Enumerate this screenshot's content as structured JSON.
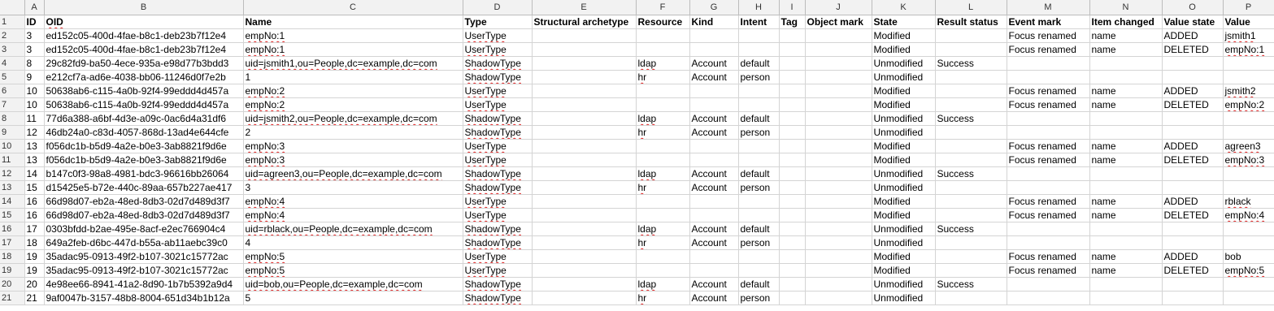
{
  "columns": [
    "A",
    "B",
    "C",
    "D",
    "E",
    "F",
    "G",
    "H",
    "I",
    "J",
    "K",
    "L",
    "M",
    "N",
    "O",
    "P"
  ],
  "header": [
    "ID",
    "OID",
    "Name",
    "Type",
    "Structural archetype",
    "Resource",
    "Kind",
    "Intent",
    "Tag",
    "Object mark",
    "State",
    "Result status",
    "Event mark",
    "Item changed",
    "Value state",
    "Value"
  ],
  "rows": [
    [
      "3",
      "ed152c05-400d-4fae-b8c1-deb23b7f12e4",
      "empNo:1",
      "UserType",
      "",
      "",
      "",
      "",
      "",
      "",
      "Modified",
      "",
      "Focus renamed",
      "name",
      "ADDED",
      "jsmith1"
    ],
    [
      "3",
      "ed152c05-400d-4fae-b8c1-deb23b7f12e4",
      "empNo:1",
      "UserType",
      "",
      "",
      "",
      "",
      "",
      "",
      "Modified",
      "",
      "Focus renamed",
      "name",
      "DELETED",
      "empNo:1"
    ],
    [
      "8",
      "29c82fd9-ba50-4ece-935a-e98d77b3bdd3",
      "uid=jsmith1,ou=People,dc=example,dc=com",
      "ShadowType",
      "",
      "ldap",
      "Account",
      "default",
      "",
      "",
      "Unmodified",
      "Success",
      "",
      "",
      "",
      ""
    ],
    [
      "9",
      "e212cf7a-ad6e-4038-bb06-11246d0f7e2b",
      "1",
      "ShadowType",
      "",
      "hr",
      "Account",
      "person",
      "",
      "",
      "Unmodified",
      "",
      "",
      "",
      "",
      ""
    ],
    [
      "10",
      "50638ab6-c115-4a0b-92f4-99eddd4d457a",
      "empNo:2",
      "UserType",
      "",
      "",
      "",
      "",
      "",
      "",
      "Modified",
      "",
      "Focus renamed",
      "name",
      "ADDED",
      "jsmith2"
    ],
    [
      "10",
      "50638ab6-c115-4a0b-92f4-99eddd4d457a",
      "empNo:2",
      "UserType",
      "",
      "",
      "",
      "",
      "",
      "",
      "Modified",
      "",
      "Focus renamed",
      "name",
      "DELETED",
      "empNo:2"
    ],
    [
      "11",
      "77d6a388-a6bf-4d3e-a09c-0ac6d4a31df6",
      "uid=jsmith2,ou=People,dc=example,dc=com",
      "ShadowType",
      "",
      "ldap",
      "Account",
      "default",
      "",
      "",
      "Unmodified",
      "Success",
      "",
      "",
      "",
      ""
    ],
    [
      "12",
      "46db24a0-c83d-4057-868d-13ad4e644cfe",
      "2",
      "ShadowType",
      "",
      "hr",
      "Account",
      "person",
      "",
      "",
      "Unmodified",
      "",
      "",
      "",
      "",
      ""
    ],
    [
      "13",
      "f056dc1b-b5d9-4a2e-b0e3-3ab8821f9d6e",
      "empNo:3",
      "UserType",
      "",
      "",
      "",
      "",
      "",
      "",
      "Modified",
      "",
      "Focus renamed",
      "name",
      "ADDED",
      "agreen3"
    ],
    [
      "13",
      "f056dc1b-b5d9-4a2e-b0e3-3ab8821f9d6e",
      "empNo:3",
      "UserType",
      "",
      "",
      "",
      "",
      "",
      "",
      "Modified",
      "",
      "Focus renamed",
      "name",
      "DELETED",
      "empNo:3"
    ],
    [
      "14",
      "b147c0f3-98a8-4981-bdc3-96616bb26064",
      "uid=agreen3,ou=People,dc=example,dc=com",
      "ShadowType",
      "",
      "ldap",
      "Account",
      "default",
      "",
      "",
      "Unmodified",
      "Success",
      "",
      "",
      "",
      ""
    ],
    [
      "15",
      "d15425e5-b72e-440c-89aa-657b227ae417",
      "3",
      "ShadowType",
      "",
      "hr",
      "Account",
      "person",
      "",
      "",
      "Unmodified",
      "",
      "",
      "",
      "",
      ""
    ],
    [
      "16",
      "66d98d07-eb2a-48ed-8db3-02d7d489d3f7",
      "empNo:4",
      "UserType",
      "",
      "",
      "",
      "",
      "",
      "",
      "Modified",
      "",
      "Focus renamed",
      "name",
      "ADDED",
      "rblack"
    ],
    [
      "16",
      "66d98d07-eb2a-48ed-8db3-02d7d489d3f7",
      "empNo:4",
      "UserType",
      "",
      "",
      "",
      "",
      "",
      "",
      "Modified",
      "",
      "Focus renamed",
      "name",
      "DELETED",
      "empNo:4"
    ],
    [
      "17",
      "0303bfdd-b2ae-495e-8acf-e2ec766904c4",
      "uid=rblack,ou=People,dc=example,dc=com",
      "ShadowType",
      "",
      "ldap",
      "Account",
      "default",
      "",
      "",
      "Unmodified",
      "Success",
      "",
      "",
      "",
      ""
    ],
    [
      "18",
      "649a2feb-d6bc-447d-b55a-ab11aebc39c0",
      "4",
      "ShadowType",
      "",
      "hr",
      "Account",
      "person",
      "",
      "",
      "Unmodified",
      "",
      "",
      "",
      "",
      ""
    ],
    [
      "19",
      "35adac95-0913-49f2-b107-3021c15772ac",
      "empNo:5",
      "UserType",
      "",
      "",
      "",
      "",
      "",
      "",
      "Modified",
      "",
      "Focus renamed",
      "name",
      "ADDED",
      "bob"
    ],
    [
      "19",
      "35adac95-0913-49f2-b107-3021c15772ac",
      "empNo:5",
      "UserType",
      "",
      "",
      "",
      "",
      "",
      "",
      "Modified",
      "",
      "Focus renamed",
      "name",
      "DELETED",
      "empNo:5"
    ],
    [
      "20",
      "4e98ee66-8941-41a2-8d90-1b7b5392a9d4",
      "uid=bob,ou=People,dc=example,dc=com",
      "ShadowType",
      "",
      "ldap",
      "Account",
      "default",
      "",
      "",
      "Unmodified",
      "Success",
      "",
      "",
      "",
      ""
    ],
    [
      "21",
      "9af0047b-3157-48b8-8004-651d34b1b12a",
      "5",
      "ShadowType",
      "",
      "hr",
      "Account",
      "person",
      "",
      "",
      "Unmodified",
      "",
      "",
      "",
      "",
      ""
    ]
  ]
}
